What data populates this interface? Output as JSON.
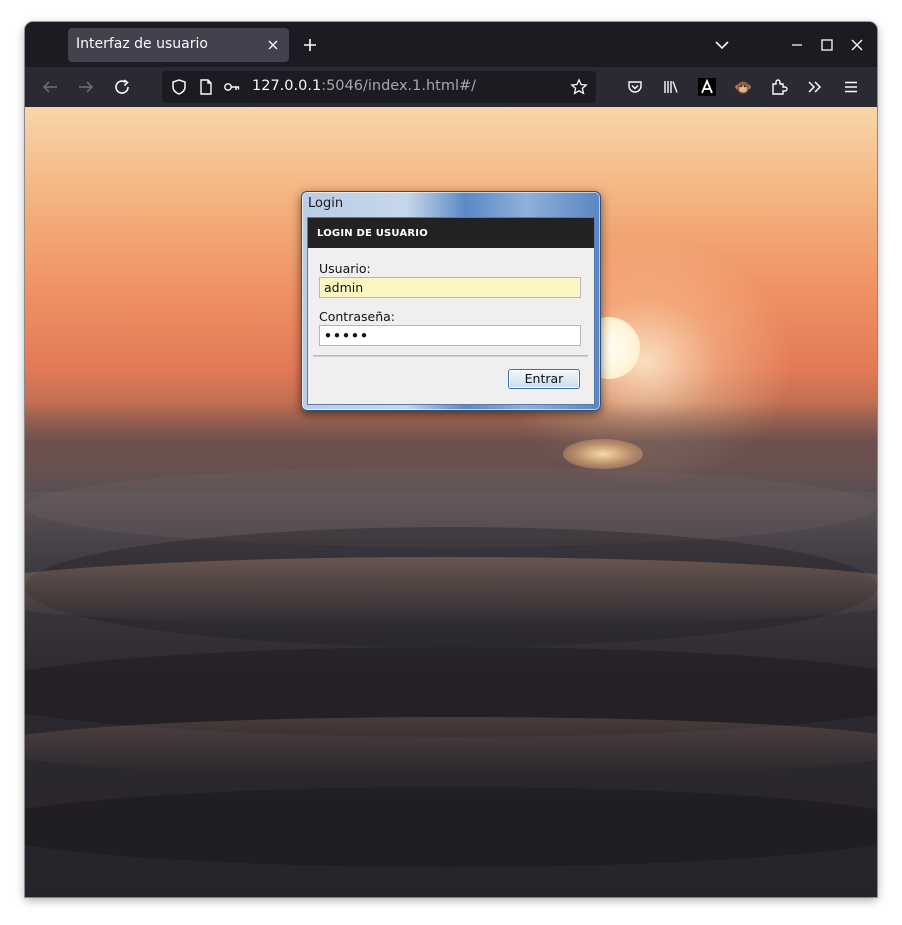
{
  "browser": {
    "tab_title": "Interfaz de usuario",
    "url_host": "127.0.0.1",
    "url_rest": ":5046/index.1.html#/"
  },
  "icons": {
    "tab_close": "close-icon",
    "new_tab": "plus-icon",
    "tab_list": "chevron-down-icon",
    "minimize": "minimize-icon",
    "maximize": "maximize-icon",
    "close_window": "close-icon",
    "back": "arrow-left-icon",
    "forward": "arrow-right-icon",
    "reload": "reload-icon",
    "shield": "shield-icon",
    "page": "page-icon",
    "key": "key-icon",
    "bookmark": "star-icon",
    "pocket": "pocket-icon",
    "library": "library-icon",
    "reader": "font-icon",
    "extension_monkey": "monkey-icon",
    "extensions": "puzzle-icon",
    "overflow": "double-chevron-icon",
    "menu": "hamburger-icon"
  },
  "dialog": {
    "title": "Login",
    "header": "LOGIN DE USUARIO",
    "username_label": "Usuario:",
    "username_value": "admin",
    "password_label": "Contraseña:",
    "password_mask": "•••••",
    "submit_label": "Entrar"
  },
  "colors": {
    "browser_dark": "#1c1b22",
    "navbar": "#2b2a33",
    "dialog_header": "#222222",
    "username_field_bg": "#fdf6c2"
  }
}
